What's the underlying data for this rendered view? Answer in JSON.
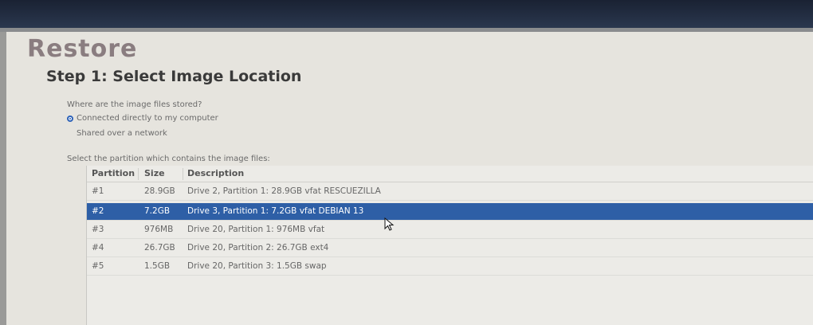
{
  "window": {
    "title": "Restore",
    "step_title": "Step 1: Select Image Location"
  },
  "source": {
    "question": "Where are the image files stored?",
    "options": [
      {
        "label": "Connected directly to my computer",
        "selected": true
      },
      {
        "label": "Shared over a network",
        "selected": false
      }
    ]
  },
  "partitions": {
    "prompt": "Select the partition which contains the image files:",
    "columns": [
      "Partition",
      "Size",
      "Description"
    ],
    "selected_index": 1,
    "rows": [
      {
        "partition": "#1",
        "size": "28.9GB",
        "description": "Drive 2, Partition 1: 28.9GB vfat RESCUEZILLA"
      },
      {
        "partition": "#2",
        "size": "7.2GB",
        "description": "Drive 3, Partition 1: 7.2GB vfat DEBIAN 13"
      },
      {
        "partition": "#3",
        "size": "976MB",
        "description": "Drive 20, Partition 1: 976MB vfat"
      },
      {
        "partition": "#4",
        "size": "26.7GB",
        "description": "Drive 20, Partition 2: 26.7GB ext4"
      },
      {
        "partition": "#5",
        "size": "1.5GB",
        "description": "Drive 20, Partition 3: 1.5GB swap"
      }
    ]
  },
  "colors": {
    "selection": "#2e5fa6",
    "radio": "#2d62b8",
    "title": "#8a7d80"
  }
}
